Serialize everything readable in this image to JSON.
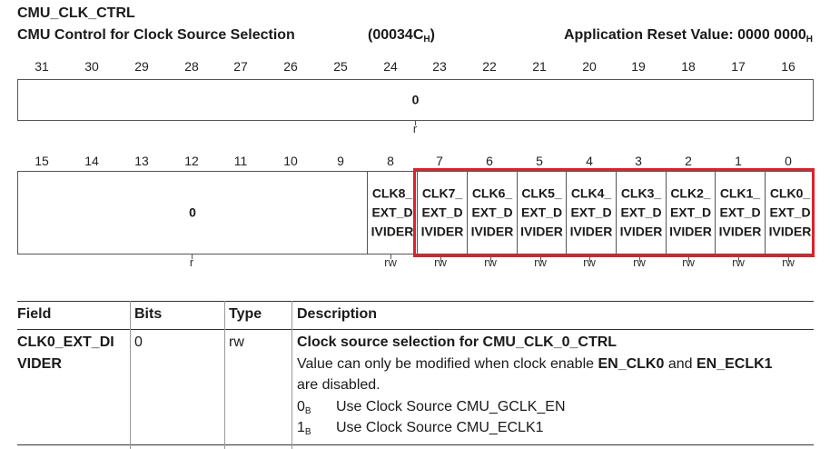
{
  "register": {
    "name": "CMU_CLK_CTRL",
    "title": "CMU Control for Clock Source Selection",
    "offset_value": "00034C",
    "offset_sub": "H",
    "reset_label": "Application Reset Value: 0000 0000",
    "reset_sub": "H"
  },
  "upper": {
    "bits": [
      "31",
      "30",
      "29",
      "28",
      "27",
      "26",
      "25",
      "24",
      "23",
      "22",
      "21",
      "20",
      "19",
      "18",
      "17",
      "16"
    ],
    "field_value": "0",
    "access": "r"
  },
  "lower": {
    "bits": [
      "15",
      "14",
      "13",
      "12",
      "11",
      "10",
      "9",
      "8",
      "7",
      "6",
      "5",
      "4",
      "3",
      "2",
      "1",
      "0"
    ],
    "reserved_value": "0",
    "reserved_access": "r",
    "fields": [
      {
        "l1": "CLK8_",
        "l2": "EXT_D",
        "l3": "IVIDER",
        "access": "rw"
      },
      {
        "l1": "CLK7_",
        "l2": "EXT_D",
        "l3": "IVIDER",
        "access": "rw"
      },
      {
        "l1": "CLK6_",
        "l2": "EXT_D",
        "l3": "IVIDER",
        "access": "rw"
      },
      {
        "l1": "CLK5_",
        "l2": "EXT_D",
        "l3": "IVIDER",
        "access": "rw"
      },
      {
        "l1": "CLK4_",
        "l2": "EXT_D",
        "l3": "IVIDER",
        "access": "rw"
      },
      {
        "l1": "CLK3_",
        "l2": "EXT_D",
        "l3": "IVIDER",
        "access": "rw"
      },
      {
        "l1": "CLK2_",
        "l2": "EXT_D",
        "l3": "IVIDER",
        "access": "rw"
      },
      {
        "l1": "CLK1_",
        "l2": "EXT_D",
        "l3": "IVIDER",
        "access": "rw"
      },
      {
        "l1": "CLK0_",
        "l2": "EXT_D",
        "l3": "IVIDER",
        "access": "rw"
      }
    ]
  },
  "highlight_color": "#e0202a",
  "table": {
    "headers": {
      "field": "Field",
      "bits": "Bits",
      "type": "Type",
      "description": "Description"
    },
    "row": {
      "field_l1": "CLK0_EXT_DI",
      "field_l2": "VIDER",
      "bits": "0",
      "type": "rw",
      "desc_title": "Clock source selection for CMU_CLK_0_CTRL",
      "desc_text1": "Value can only be modified when clock enable ",
      "desc_b1": "EN_CLK0",
      "desc_and": " and ",
      "desc_b2": "EN_ECLK1",
      "desc_text2": "are disabled.",
      "options": [
        {
          "val": "0",
          "sub": "B",
          "text": "Use Clock Source CMU_GCLK_EN"
        },
        {
          "val": "1",
          "sub": "B",
          "text": "Use Clock Source CMU_ECLK1"
        }
      ]
    }
  }
}
